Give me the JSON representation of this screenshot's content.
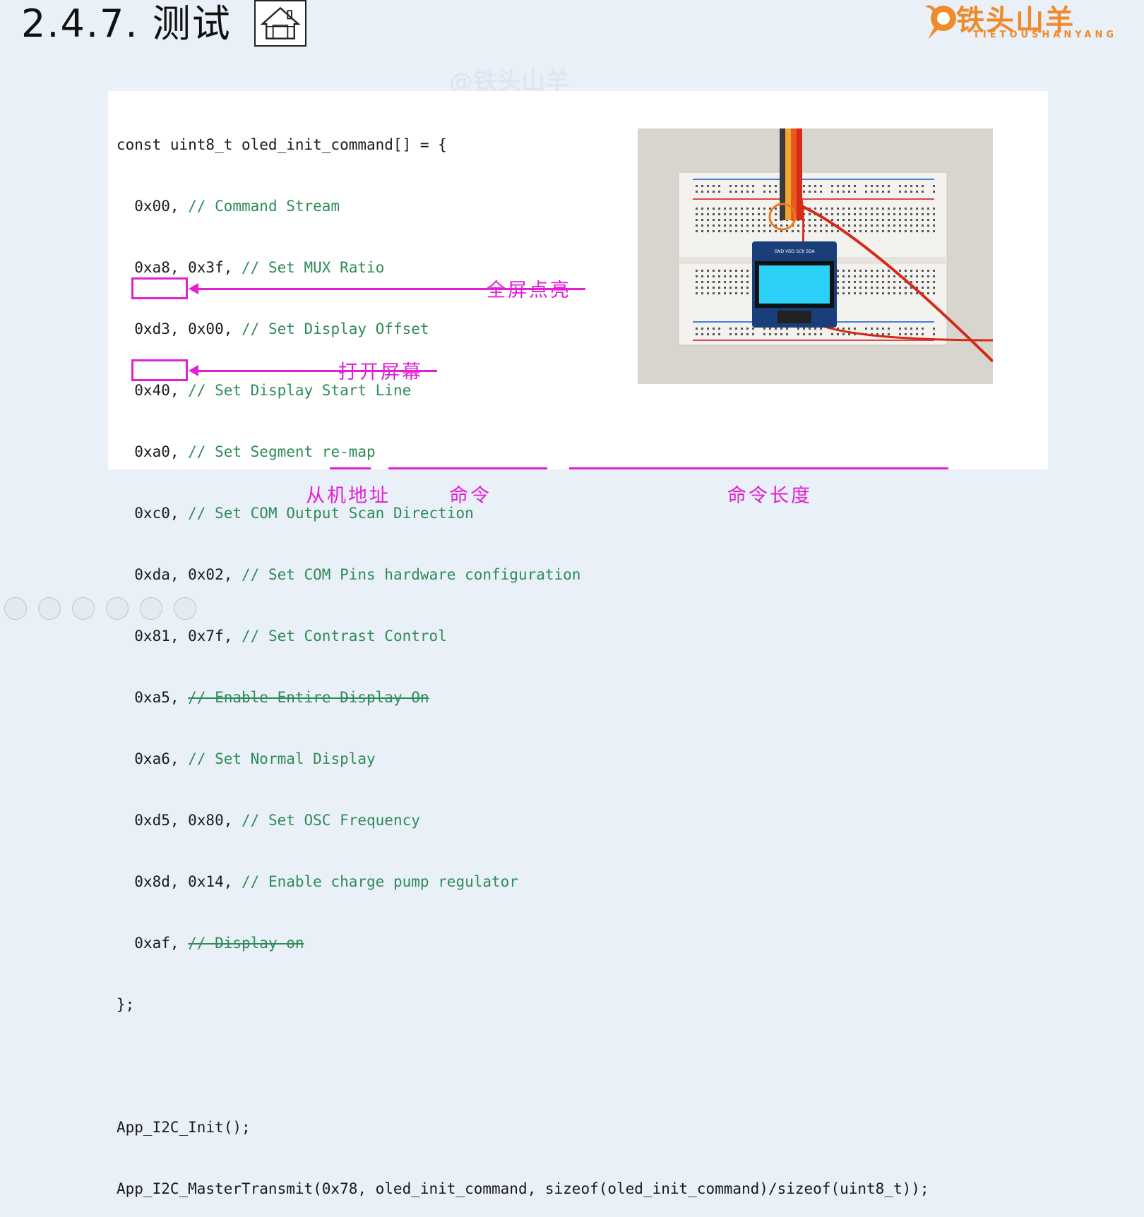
{
  "header": {
    "title": "2.4.7. 测试",
    "home_icon": "home-icon"
  },
  "logo": {
    "main": "铁头山羊",
    "sub": "TIETOUSHANYANG"
  },
  "watermark": "@铁头山羊",
  "code": {
    "lines": [
      {
        "code": "const uint8_t oled_init_command[] = {",
        "comment": ""
      },
      {
        "code": "  0x00, ",
        "comment": "// Command Stream"
      },
      {
        "code": "  0xa8, 0x3f, ",
        "comment": "// Set MUX Ratio"
      },
      {
        "code": "  0xd3, 0x00, ",
        "comment": "// Set Display Offset"
      },
      {
        "code": "  0x40, ",
        "comment": "// Set Display Start Line"
      },
      {
        "code": "  0xa0, ",
        "comment": "// Set Segment re-map"
      },
      {
        "code": "  0xc0, ",
        "comment": "// Set COM Output Scan Direction"
      },
      {
        "code": "  0xda, 0x02, ",
        "comment": "// Set COM Pins hardware configuration"
      },
      {
        "code": "  0x81, 0x7f, ",
        "comment": "// Set Contrast Control"
      },
      {
        "code": "  0xa5, ",
        "comment": "// Enable Entire Display On"
      },
      {
        "code": "  0xa6, ",
        "comment": "// Set Normal Display"
      },
      {
        "code": "  0xd5, 0x80, ",
        "comment": "// Set OSC Frequency"
      },
      {
        "code": "  0x8d, 0x14, ",
        "comment": "// Enable charge pump regulator"
      },
      {
        "code": "  0xaf, ",
        "comment": "// Display on"
      },
      {
        "code": "};",
        "comment": ""
      },
      {
        "code": "",
        "comment": ""
      },
      {
        "code": "App_I2C_Init();",
        "comment": ""
      },
      {
        "code": "App_I2C_MasterTransmit(0x78, oled_init_command, sizeof(oled_init_command)/sizeof(uint8_t));",
        "comment": ""
      }
    ]
  },
  "annotations": {
    "display_on_all": "全屏点亮",
    "open_screen": "打开屏幕",
    "slave_address": "从机地址",
    "command": "命令",
    "command_length": "命令长度"
  },
  "oled_pins": "GND VDD SCK SDA",
  "colors": {
    "annotation": "#e21ed6",
    "comment": "#2e8b57",
    "background": "#e9f0f8",
    "logo": "#f08a2a",
    "oled_screen": "#2ad0f5"
  }
}
